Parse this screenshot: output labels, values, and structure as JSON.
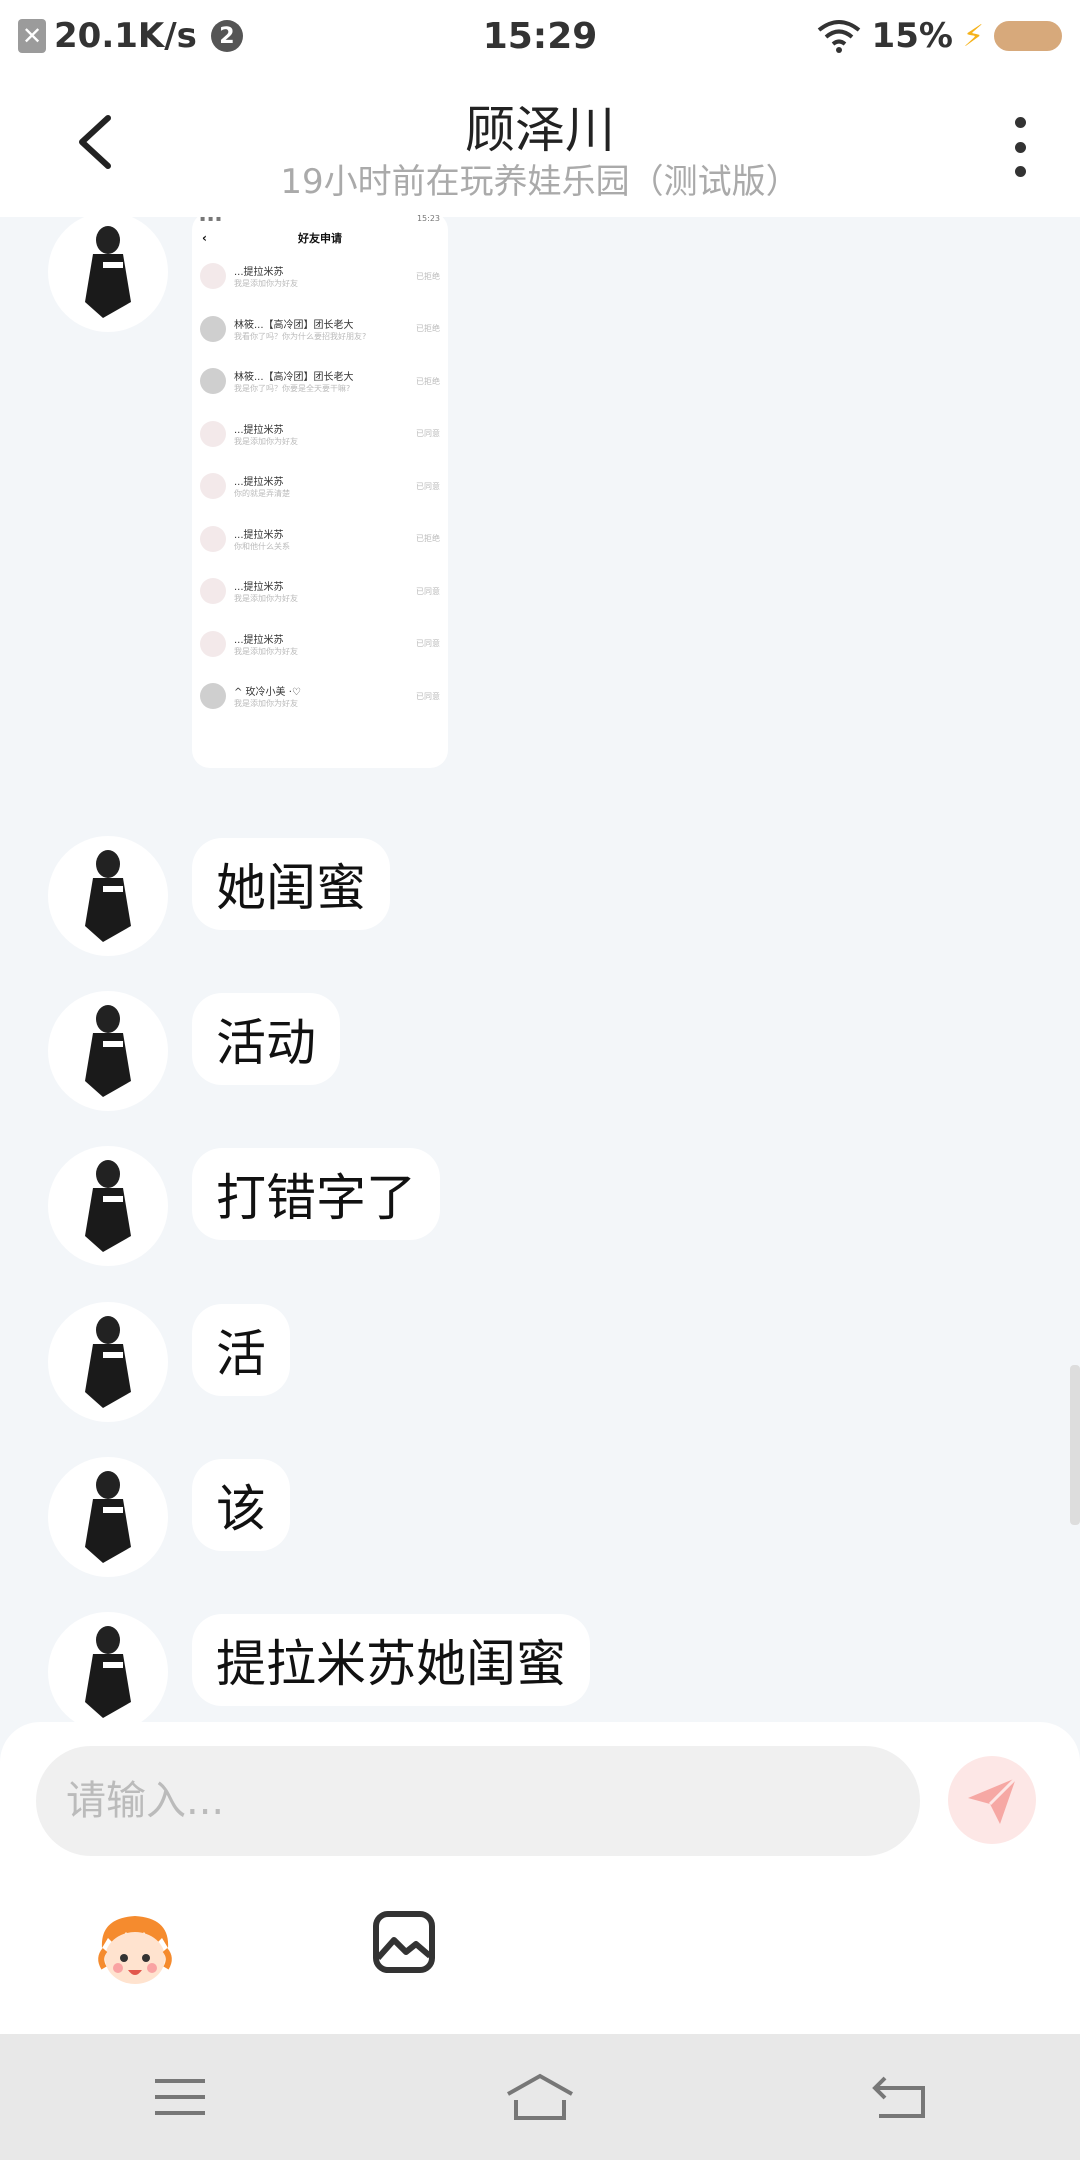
{
  "status_bar": {
    "speed": "20.1K/s",
    "badge": "2",
    "time": "15:29",
    "battery": "15%"
  },
  "header": {
    "title": "顾泽川",
    "subtitle": "19小时前在玩养娃乐园（测试版）"
  },
  "screenshot_message": {
    "title": "好友申请",
    "time": "15:23",
    "rows": [
      {
        "name": "...提拉米苏",
        "msg": "我是添加你为好友",
        "status": "已拒绝"
      },
      {
        "name": "林筱...【高冷团】团长老大",
        "msg": "我看你了吗？你为什么要招我好朋友?",
        "status": "已拒绝"
      },
      {
        "name": "林筱...【高冷团】团长老大",
        "msg": "我是你了吗？你要是全天要干嘛?",
        "status": "已拒绝"
      },
      {
        "name": "...提拉米苏",
        "msg": "我是添加你为好友",
        "status": "已同意"
      },
      {
        "name": "...提拉米苏",
        "msg": "你的就是弄清楚",
        "status": "已同意"
      },
      {
        "name": "...提拉米苏",
        "msg": "你和他什么关系",
        "status": "已拒绝"
      },
      {
        "name": "...提拉米苏",
        "msg": "我是添加你为好友",
        "status": "已同意"
      },
      {
        "name": "...提拉米苏",
        "msg": "我是添加你为好友",
        "status": "已同意"
      },
      {
        "name": "^ 玫冷小美 ·♡",
        "msg": "我是添加你为好友",
        "status": "已同意"
      }
    ]
  },
  "messages": [
    {
      "text": "她闺蜜"
    },
    {
      "text": "活动"
    },
    {
      "text": "打错字了"
    },
    {
      "text": "活"
    },
    {
      "text": "该"
    },
    {
      "text": "提拉米苏她闺蜜"
    }
  ],
  "composer": {
    "placeholder": "请输入..."
  },
  "colors": {
    "background": "#f3f6f9",
    "send_button": "#fde7e6",
    "send_arrow": "#f6a8a4"
  }
}
